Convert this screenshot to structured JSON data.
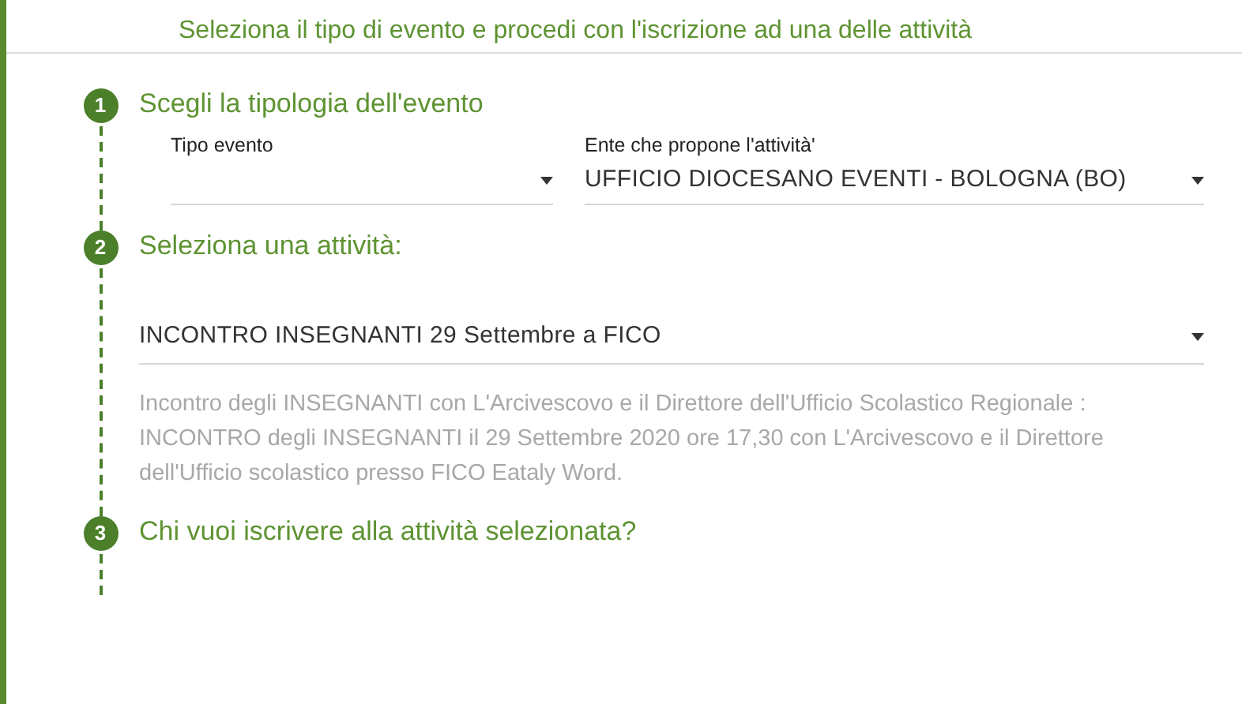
{
  "header": {
    "text": "Seleziona il tipo di evento e procedi con l'iscrizione ad una delle attività"
  },
  "steps": [
    {
      "number": "1",
      "title": "Scegli la tipologia dell'evento",
      "fields": [
        {
          "label": "Tipo evento"
        },
        {
          "label": "Ente che propone l'attività'",
          "value": "UFFICIO DIOCESANO EVENTI - BOLOGNA (BO)"
        }
      ]
    },
    {
      "number": "2",
      "title": "Seleziona una attività:",
      "select": {
        "value": "INCONTRO INSEGNANTI 29 Settembre a FICO"
      },
      "description": "Incontro degli INSEGNANTI con L'Arcivescovo e il Direttore dell'Ufficio Scolastico Regionale : INCONTRO degli INSEGNANTI il 29 Settembre 2020 ore 17,30 con L'Arcivescovo e il Direttore dell'Ufficio scolastico presso FICO Eataly Word."
    },
    {
      "number": "3",
      "title": "Chi vuoi iscrivere alla attività selezionata?"
    }
  ]
}
